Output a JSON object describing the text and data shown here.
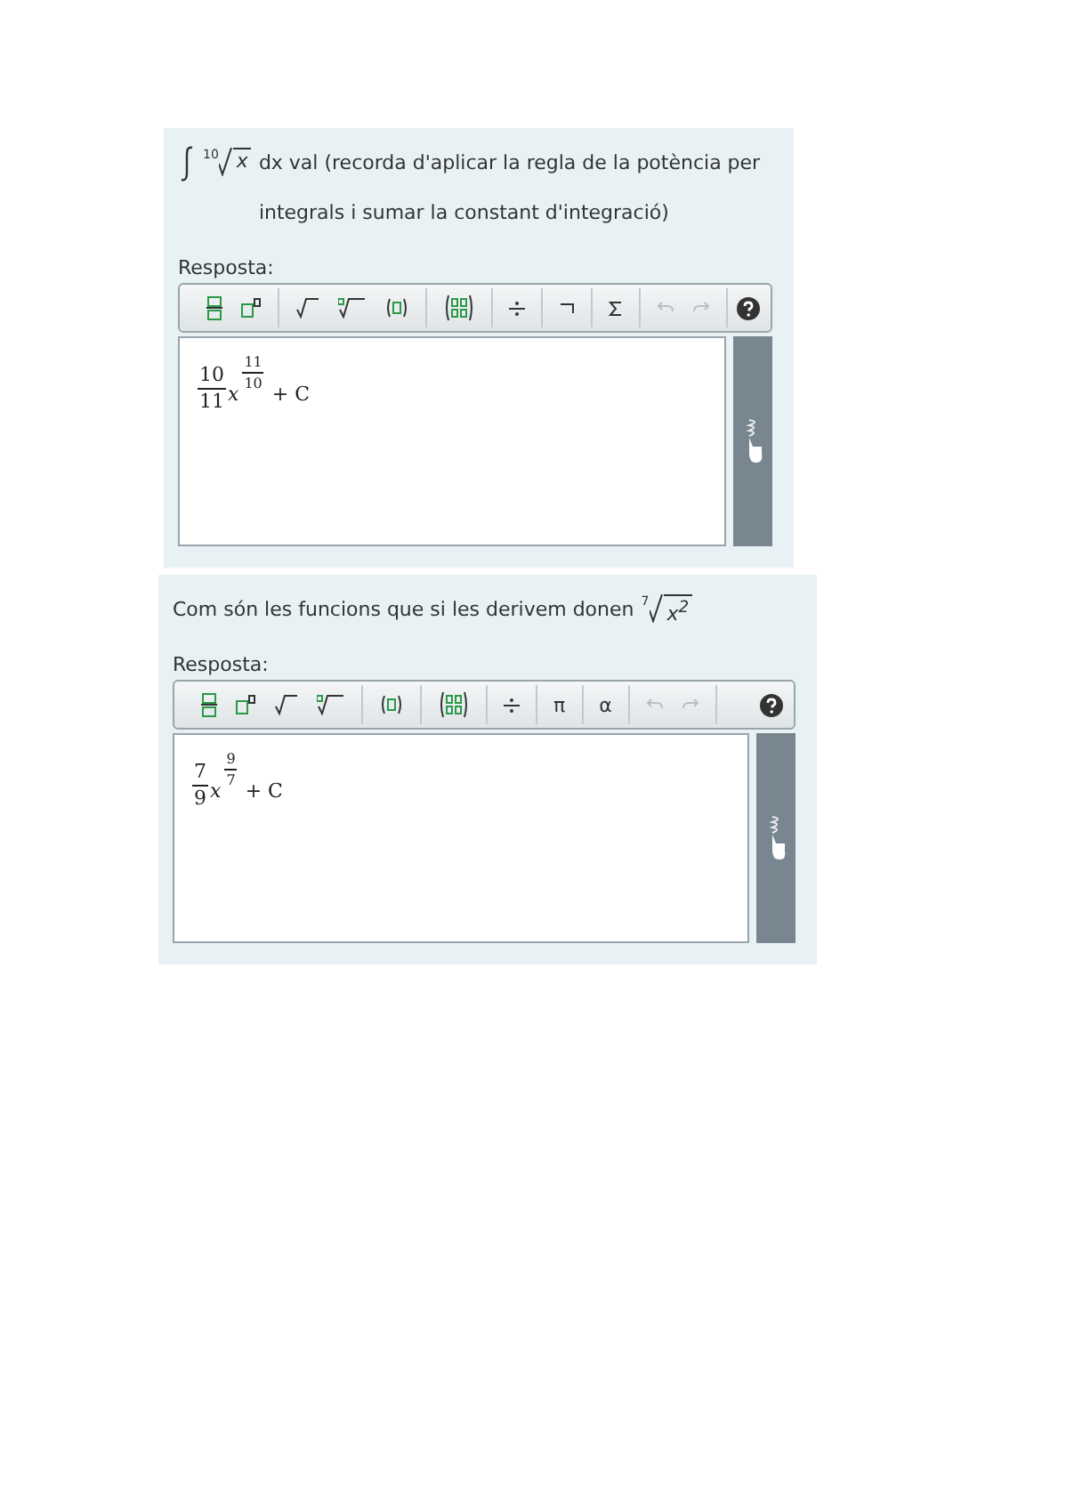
{
  "questions": [
    {
      "prompt": {
        "kind": "integral",
        "root_index": "10",
        "radicand": "x",
        "text": "dx val (recorda d'aplicar la regla de la potència per integrals i sumar la constant d'integració)"
      },
      "answer_label": "Resposta:",
      "toolbar": [
        [
          {
            "kind": "fraction"
          },
          {
            "kind": "superscript"
          }
        ],
        [
          {
            "kind": "sqrt"
          },
          {
            "kind": "nthroot"
          },
          {
            "kind": "brackets"
          }
        ],
        [
          {
            "kind": "matrix"
          }
        ],
        [
          {
            "kind": "divide"
          }
        ],
        [
          {
            "kind": "logic"
          }
        ],
        [
          {
            "kind": "sigma"
          }
        ],
        [
          {
            "kind": "undo",
            "disabled": true
          },
          {
            "kind": "redo",
            "disabled": true
          }
        ]
      ],
      "answer": {
        "numerator": "10",
        "denominator": "11",
        "base": "x",
        "exp_numerator": "11",
        "exp_denominator": "10",
        "tail": "+ C"
      }
    },
    {
      "prompt": {
        "kind": "root_end",
        "root_index": "7",
        "radicand": "x$^{2}$",
        "text": "Com són les funcions que si les derivem donen"
      },
      "answer_label": "Resposta:",
      "toolbar": [
        [
          {
            "kind": "fraction"
          },
          {
            "kind": "superscript"
          },
          {
            "kind": "sqrt"
          },
          {
            "kind": "nthroot"
          }
        ],
        [
          {
            "kind": "brackets"
          }
        ],
        [
          {
            "kind": "matrix"
          }
        ],
        [
          {
            "kind": "divide"
          }
        ],
        [
          {
            "kind": "text",
            "label": "π"
          }
        ],
        [
          {
            "kind": "text",
            "label": "α"
          }
        ],
        [
          {
            "kind": "undo",
            "disabled": true
          },
          {
            "kind": "redo",
            "disabled": true
          }
        ]
      ],
      "answer": {
        "numerator": "7",
        "denominator": "9",
        "base": "x",
        "exp_numerator": "9",
        "exp_denominator": "7",
        "tail": "+ C"
      }
    }
  ]
}
